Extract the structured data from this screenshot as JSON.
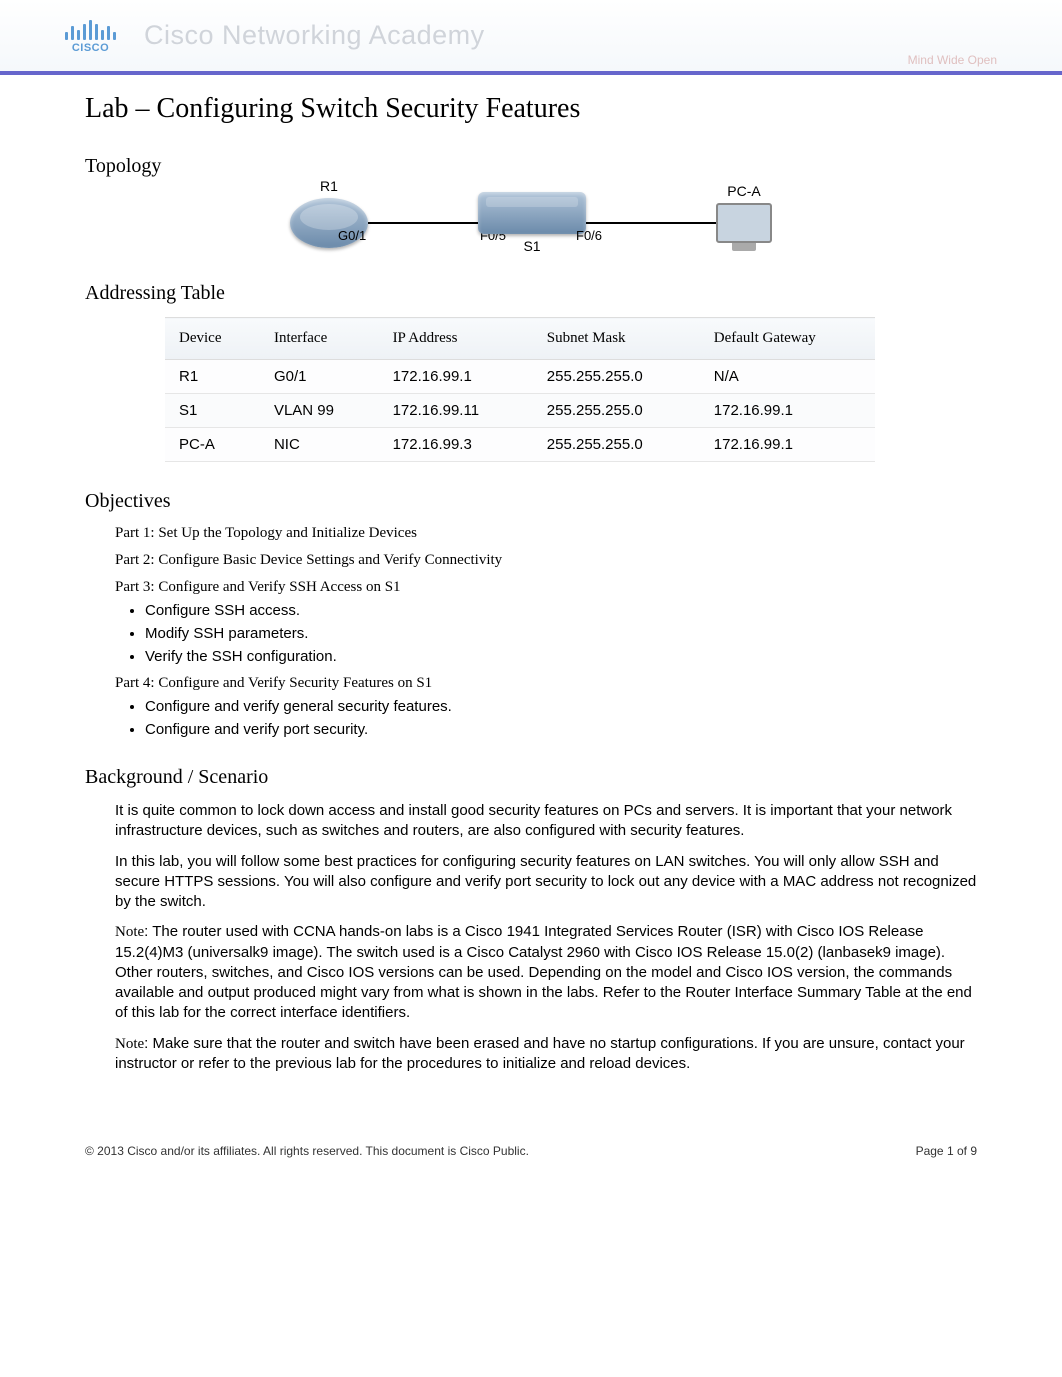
{
  "header": {
    "logo_text": "CISCO",
    "academy_title": "Cisco Networking Academy",
    "tagline": "Mind Wide Open"
  },
  "title": "Lab – Configuring Switch Security Features",
  "sections": {
    "topology_heading": "Topology",
    "addressing_heading": "Addressing Table",
    "objectives_heading": "Objectives",
    "background_heading": "Background / Scenario"
  },
  "topology": {
    "devices": {
      "r1": "R1",
      "s1": "S1",
      "pca": "PC-A"
    },
    "ports": {
      "g01": "G0/1",
      "f05": "F0/5",
      "f06": "F0/6"
    }
  },
  "addressing_table": {
    "headers": [
      "Device",
      "Interface",
      "IP Address",
      "Subnet Mask",
      "Default Gateway"
    ],
    "rows": [
      {
        "device": "R1",
        "interface": "G0/1",
        "ip": "172.16.99.1",
        "mask": "255.255.255.0",
        "gateway": "N/A"
      },
      {
        "device": "S1",
        "interface": "VLAN 99",
        "ip": "172.16.99.11",
        "mask": "255.255.255.0",
        "gateway": "172.16.99.1"
      },
      {
        "device": "PC-A",
        "interface": "NIC",
        "ip": "172.16.99.3",
        "mask": "255.255.255.0",
        "gateway": "172.16.99.1"
      }
    ]
  },
  "objectives": {
    "part1": "Part 1: Set Up the Topology and Initialize Devices",
    "part2": "Part 2: Configure Basic Device Settings and Verify Connectivity",
    "part3": "Part 3: Configure and Verify SSH Access on S1",
    "part3_items": [
      "Configure SSH access.",
      "Modify SSH parameters.",
      "Verify the SSH configuration."
    ],
    "part4": "Part 4: Configure and Verify Security Features on S1",
    "part4_items": [
      "Configure and verify general security features.",
      "Configure and verify port security."
    ]
  },
  "background": {
    "p1": "It is quite common to lock down access and install good security features on PCs and servers. It is important that your network infrastructure devices, such as switches and routers, are also configured with security features.",
    "p2": "In this lab, you will follow some best practices for configuring security features on LAN switches. You will only allow SSH and secure HTTPS sessions. You will also configure and verify port security to lock out any device with a MAC address not recognized by the switch.",
    "note1_label": "Note",
    "note1_text": ": The router used with CCNA hands-on labs is a Cisco 1941 Integrated Services Router (ISR) with Cisco IOS Release 15.2(4)M3 (universalk9 image). The switch used is a Cisco Catalyst 2960 with Cisco IOS Release 15.0(2) (lanbasek9 image). Other routers, switches, and Cisco IOS versions can be used. Depending on the model and Cisco IOS version, the commands available and output produced might vary from what is shown in the labs. Refer to the Router Interface Summary Table at the end of this lab for the correct interface identifiers.",
    "note2_label": "Note",
    "note2_text": ": Make sure that the router and switch have been erased and have no startup configurations. If you are unsure, contact your instructor or refer to the previous lab for the procedures to initialize and reload devices."
  },
  "footer": {
    "copyright": "© 2013 Cisco and/or its affiliates. All rights reserved. This document is Cisco Public.",
    "page_label": "Page ",
    "page_current": "1",
    "page_of": " of ",
    "page_total": "9"
  }
}
